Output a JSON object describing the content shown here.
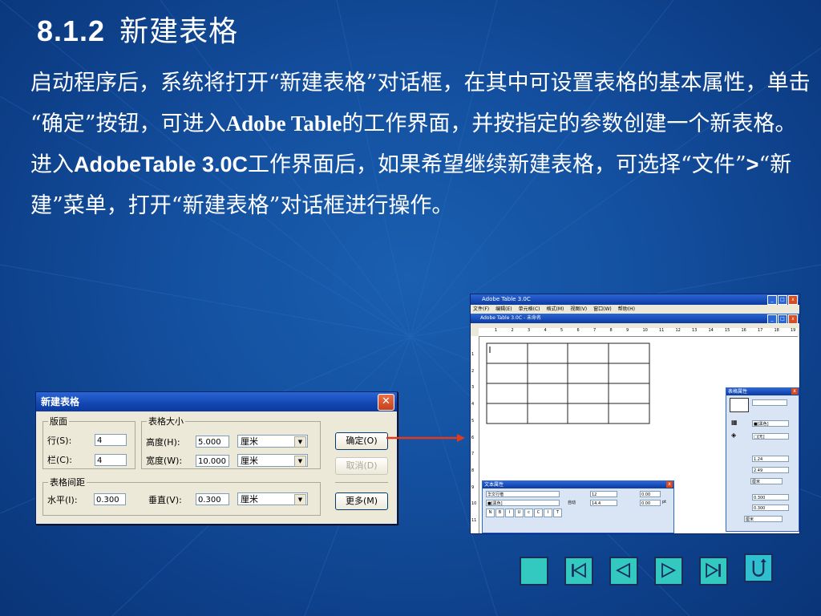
{
  "slide": {
    "title_num": "8.1.2",
    "title_text": "新建表格",
    "p1": "启动程序后，系统将打开“新建表格”对话框，在其中可设置表格的基本属性，单击 “确定”按钮，可进入",
    "p1_bold": "Adobe Table",
    "p1_end": "的工作界面，并按指定的参数创建一个新表格。",
    "p2_a": "进入",
    "p2_bold": "AdobeTable 3.0C",
    "p2_b": "工作界面后，如果希望继续新建表格，可选择“文件”",
    "p2_gt": ">",
    "p2_c": "“新建”菜单，打开“新建表格”对话框进行操作。"
  },
  "dialog": {
    "title": "新建表格",
    "close": "✕",
    "group_layout": "版面",
    "rows_label": "行(S):",
    "rows_value": "4",
    "cols_label": "栏(C):",
    "cols_value": "4",
    "group_size": "表格大小",
    "height_label": "高度(H):",
    "height_value": "5.000",
    "height_unit": "厘米",
    "width_label": "宽度(W):",
    "width_value": "10.000",
    "width_unit": "厘米",
    "group_spacing": "表格间距",
    "h_label": "水平(I):",
    "h_value": "0.300",
    "v_label": "垂直(V):",
    "v_value": "0.300",
    "v_unit": "厘米",
    "ok": "确定(O)",
    "cancel": "取消(D)",
    "more": "更多(M)"
  },
  "app": {
    "title": "Adobe Table 3.0C",
    "menu": [
      "文件(F)",
      "编辑(E)",
      "单元格(C)",
      "格式(M)",
      "视图(V)",
      "窗口(W)",
      "帮助(H)"
    ],
    "doc_title": "Adobe Table 3.0C - 未命名",
    "ruler": [
      "1",
      "2",
      "3",
      "4",
      "5",
      "6",
      "7",
      "8",
      "9",
      "10",
      "11",
      "12",
      "13",
      "14",
      "15",
      "16",
      "17",
      "18",
      "19"
    ],
    "vruler": [
      "1",
      "2",
      "3",
      "4",
      "5",
      "6",
      "7",
      "8",
      "9",
      "10",
      "11"
    ],
    "text_palette": {
      "title": "文本属性",
      "font": "华文行楷",
      "size": "12",
      "v1": "0.00",
      "color": "■[黑色]",
      "auto": "自动",
      "lead": "14.4",
      "v2": "0.00",
      "unit": "pt",
      "styles": [
        "N",
        "B",
        "I",
        "U",
        "c",
        "C",
        "I",
        "T"
      ]
    },
    "table_palette": {
      "title": "表格属性",
      "v_fill": "■[黑色]",
      "v_none": "□[无]",
      "v_a": "1.24",
      "v_b": "2.49",
      "unit1": "厘米",
      "v_c": "0.300",
      "v_d": "0.300",
      "unit2": "厘米"
    }
  },
  "nav": [
    {
      "name": "home",
      "label": "首页"
    },
    {
      "name": "first",
      "label": "第一页"
    },
    {
      "name": "prev",
      "label": "上一页"
    },
    {
      "name": "next",
      "label": "下一页"
    },
    {
      "name": "last",
      "label": "最后一页"
    },
    {
      "name": "return",
      "label": "返回"
    }
  ]
}
